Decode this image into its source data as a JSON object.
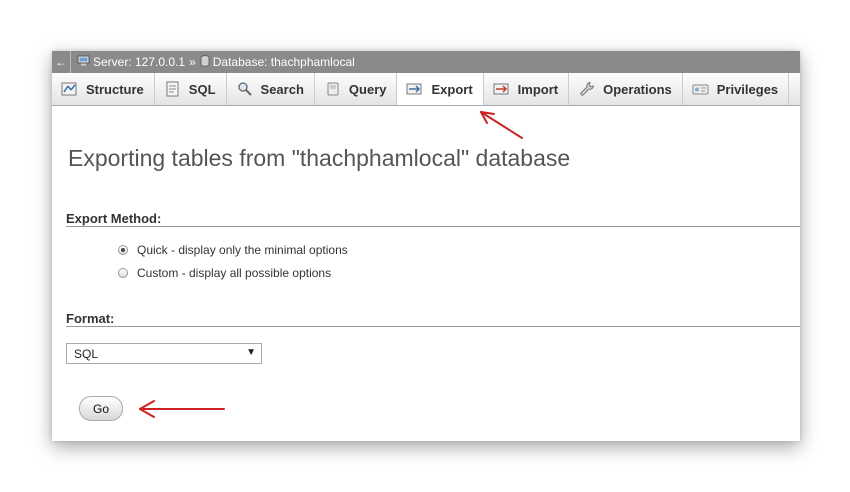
{
  "breadcrumb": {
    "back_glyph": "←",
    "server_label": "Server: 127.0.0.1",
    "separator": "»",
    "database_label": "Database: thachphamlocal"
  },
  "tabs": [
    {
      "label": "Structure",
      "icon": "structure-icon"
    },
    {
      "label": "SQL",
      "icon": "sql-icon"
    },
    {
      "label": "Search",
      "icon": "search-icon"
    },
    {
      "label": "Query",
      "icon": "query-icon"
    },
    {
      "label": "Export",
      "icon": "export-icon",
      "active": true
    },
    {
      "label": "Import",
      "icon": "import-icon"
    },
    {
      "label": "Operations",
      "icon": "wrench-icon"
    },
    {
      "label": "Privileges",
      "icon": "privileges-icon"
    }
  ],
  "main": {
    "title": "Exporting tables from \"thachphamlocal\" database",
    "export_method_label": "Export Method:",
    "options": [
      {
        "label": "Quick - display only the minimal options",
        "checked": true
      },
      {
        "label": "Custom - display all possible options",
        "checked": false
      }
    ],
    "format_label": "Format:",
    "format_selected": "SQL",
    "go_label": "Go"
  },
  "colors": {
    "breadcrumb_bg": "#8a8a8a",
    "annotation_arrow": "#cc2222"
  }
}
